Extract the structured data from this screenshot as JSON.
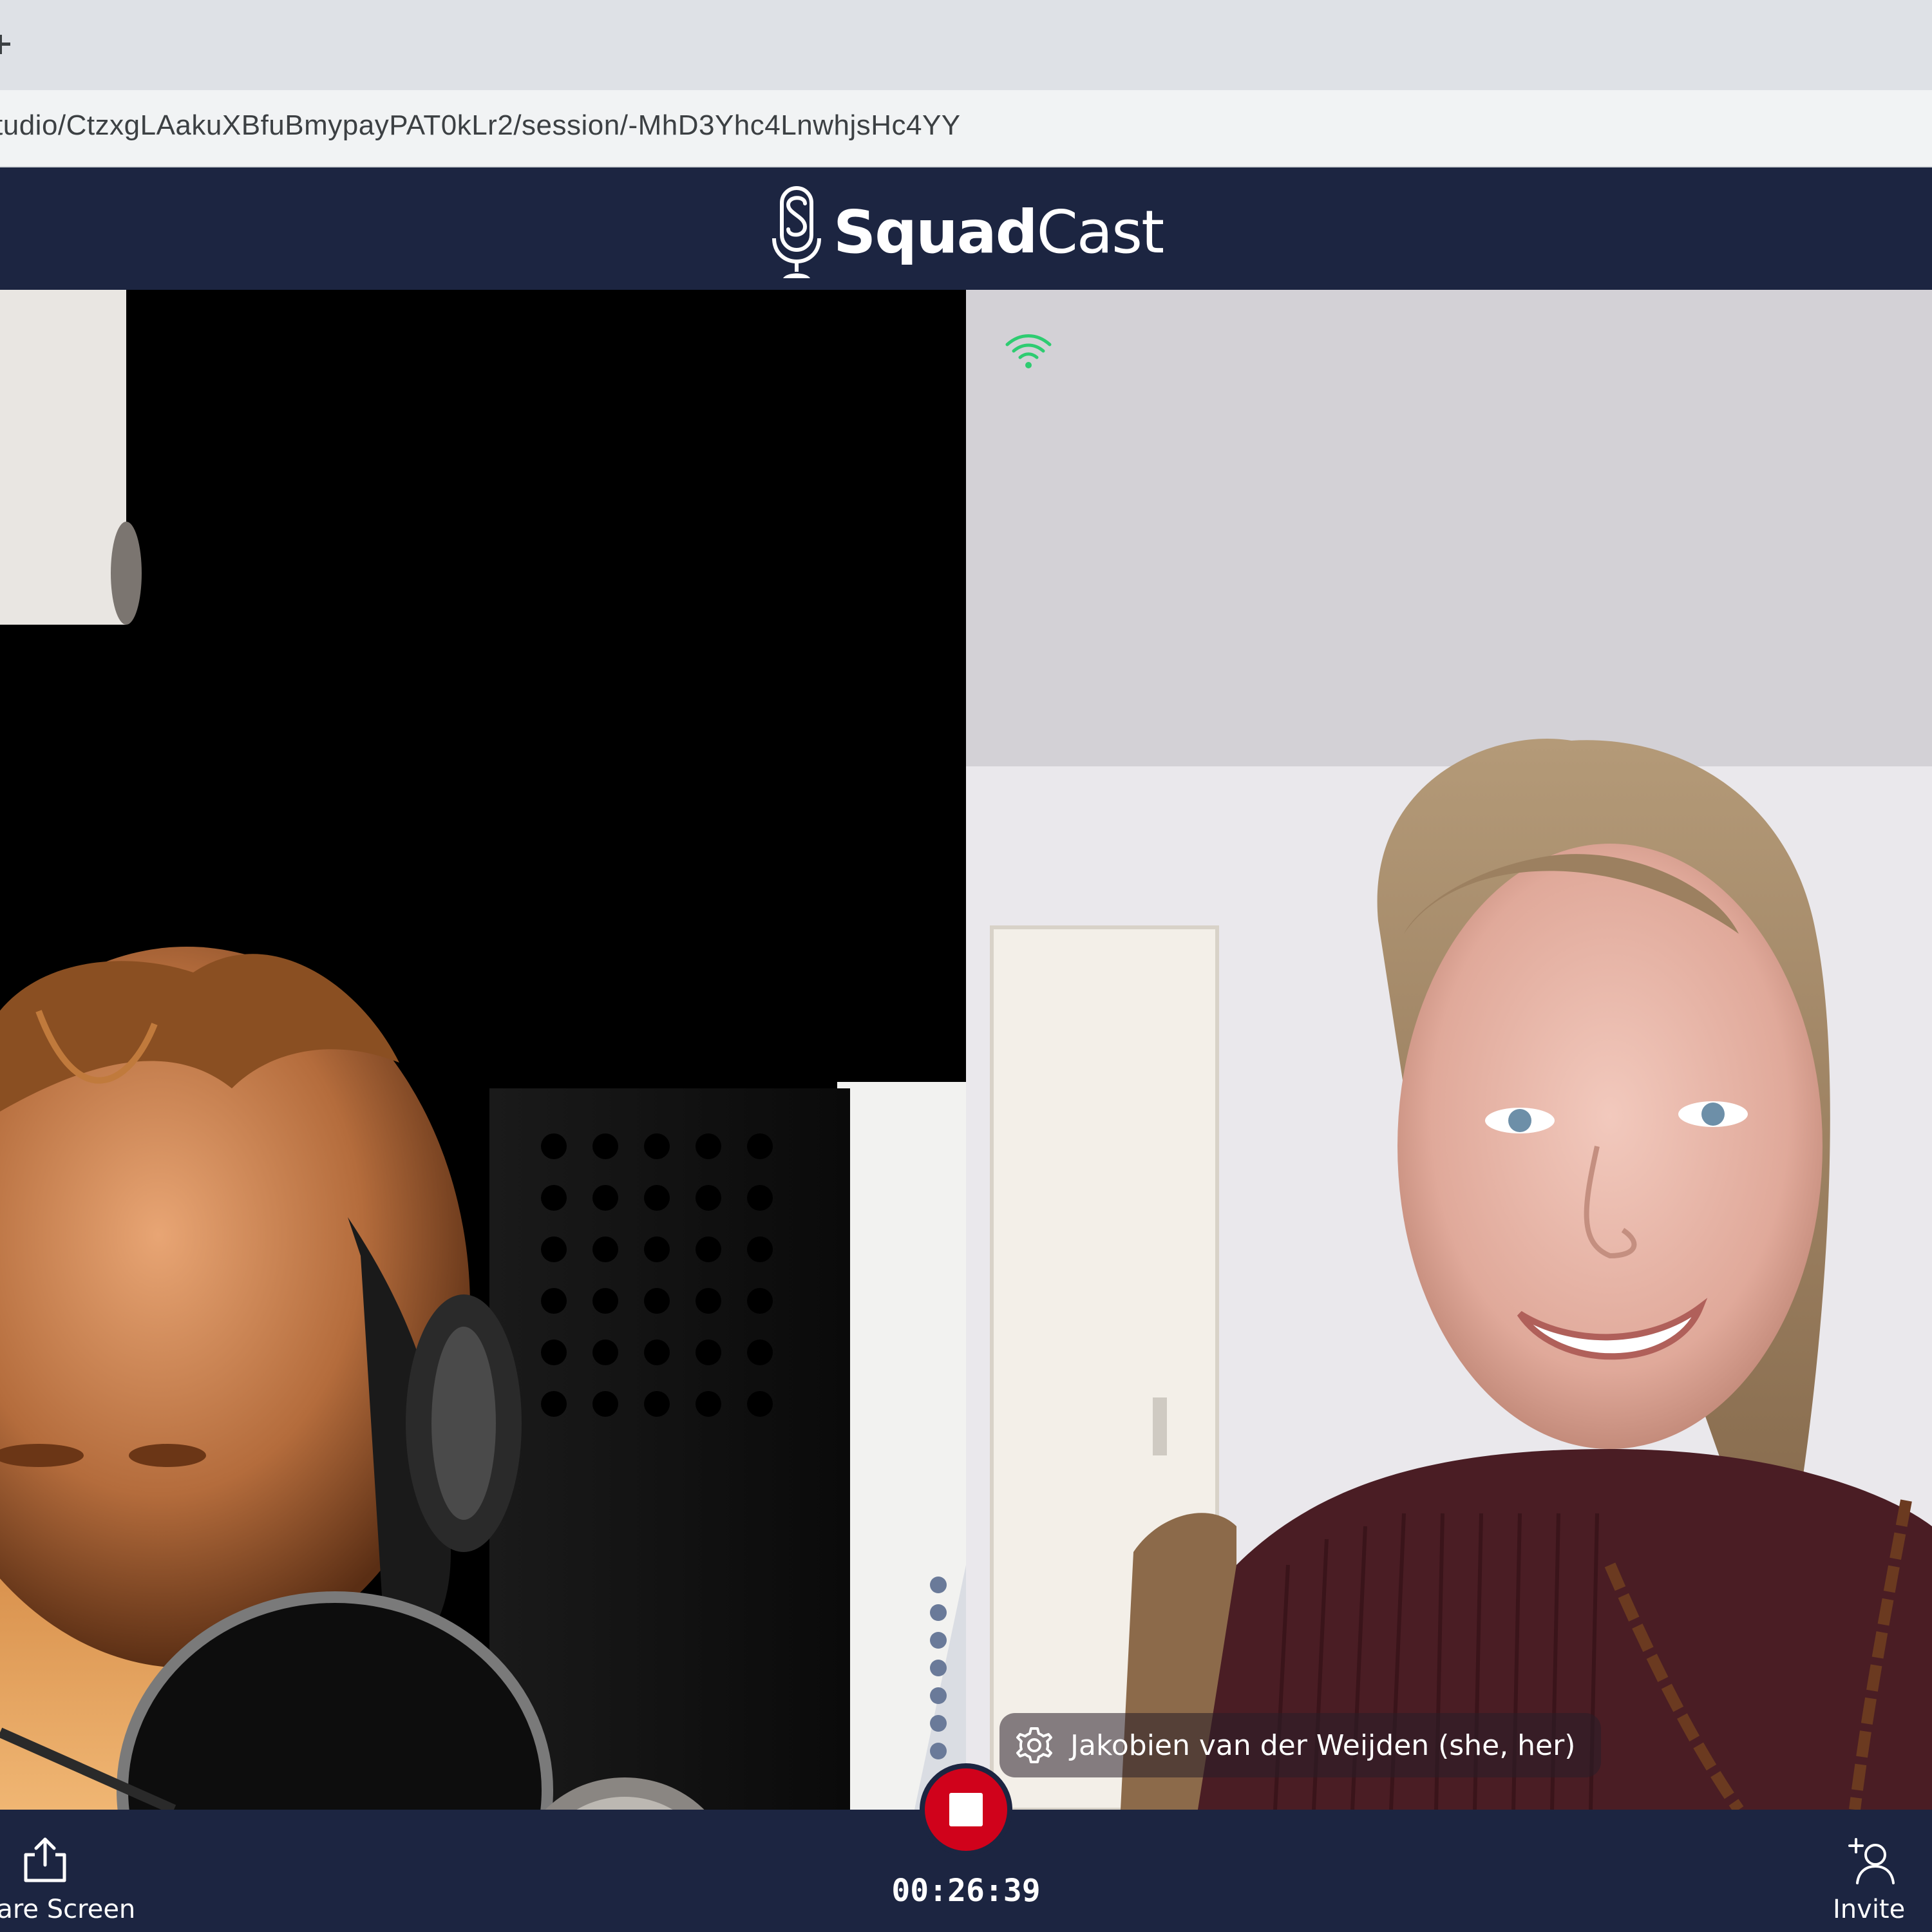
{
  "browser": {
    "url": "tudio/CtzxgLAakuXBfuBmypayPAT0kLr2/session/-MhD3Yhc4LnwhjsHc4YY"
  },
  "header": {
    "brand_bold": "Squad",
    "brand_regular": "Cast"
  },
  "participants": {
    "remote": {
      "name": "Jakobien van der Weijden (she, her)",
      "connection_color": "#2ecc71"
    }
  },
  "controls": {
    "share_label": "hare Screen",
    "timer": "00:26:39",
    "invite_label": "Invite",
    "record_color": "#d0021b"
  },
  "colors": {
    "app_background": "#1c2541"
  }
}
